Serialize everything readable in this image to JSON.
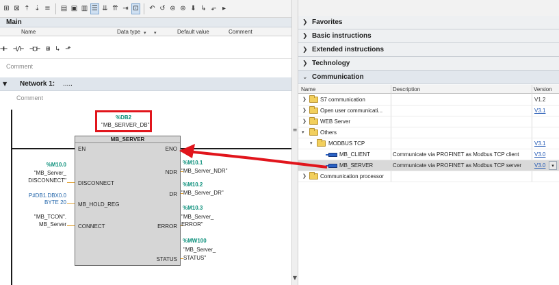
{
  "main": {
    "title": "Main",
    "interface_columns": [
      "Name",
      "Data type",
      "Default value",
      "Comment"
    ],
    "block_comment": "Comment",
    "network_label": "Network 1:",
    "network_title": ".....",
    "network_comment": "Comment"
  },
  "ladder_tools": [
    "⊣⊢",
    "⊣/⊢",
    "⊣○⊢",
    "⊞",
    "↳",
    "⬏"
  ],
  "instance": {
    "addr": "%DB2",
    "name": "\"MB_SERVER_DB\"",
    "highlight_color": "#e1151c"
  },
  "block": {
    "title": "MB_SERVER",
    "pins_in": [
      "EN",
      "DISCONNECT",
      "MB_HOLD_REG",
      "CONNECT"
    ],
    "pins_out": [
      "ENO",
      "NDR",
      "DR",
      "ERROR",
      "STATUS"
    ]
  },
  "operands_in": {
    "disconnect_addr": "%M10.0",
    "disconnect_name1": "\"MB_Server_",
    "disconnect_name2": "DISCONNECT\"",
    "hold_reg1": "P#DB1.DBX0.0",
    "hold_reg2": "BYTE 20",
    "connect_name1": "\"MB_TCON\".",
    "connect_name2": "MB_Server"
  },
  "operands_out": {
    "ndr_addr": "%M10.1",
    "ndr_name": "\"MB_Server_NDR\"",
    "dr_addr": "%M10.2",
    "dr_name": "\"MB_Server_DR\"",
    "error_addr": "%M10.3",
    "error_name1": "\"MB_Server_",
    "error_name2": "ERROR\"",
    "status_addr": "%MW100",
    "status_name1": "\"MB_Server_",
    "status_name2": "STATUS\""
  },
  "library": {
    "categories": [
      "Favorites",
      "Basic instructions",
      "Extended instructions",
      "Technology",
      "Communication"
    ],
    "columns": [
      "Name",
      "Description",
      "Version"
    ],
    "rows": [
      {
        "name": "S7 communication",
        "description": "",
        "version": "V1.2"
      },
      {
        "name": "Open user communicati...",
        "description": "",
        "version": "V3.1"
      },
      {
        "name": "WEB Server",
        "description": "",
        "version": ""
      },
      {
        "name": "Others",
        "description": "",
        "version": ""
      },
      {
        "name": "MODBUS TCP",
        "description": "",
        "version": "V3.1"
      },
      {
        "name": "MB_CLIENT",
        "description": "Communicate via PROFINET as Modbus TCP client",
        "version": "V3.0"
      },
      {
        "name": "MB_SERVER",
        "description": "Communicate via PROFINET as Modbus TCP server",
        "version": "V3.0"
      },
      {
        "name": "Communication processor",
        "description": "",
        "version": ""
      }
    ]
  },
  "colors": {
    "annotation_red": "#e1151c",
    "operand_address": "#0a8f7a",
    "link_blue": "#1e55b3"
  }
}
